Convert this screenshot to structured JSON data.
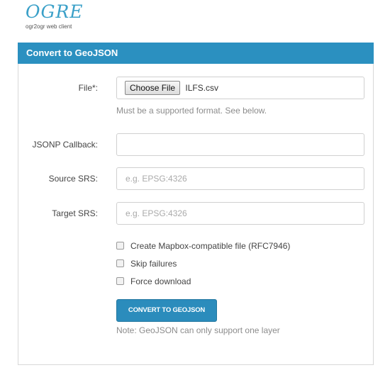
{
  "brand": {
    "logo_text": "OGRE",
    "tagline": "ogr2ogr web client"
  },
  "panel": {
    "title": "Convert to GeoJSON"
  },
  "form": {
    "file": {
      "label": "File*:",
      "button_label": "Choose File",
      "selected_file": "ILFS.csv",
      "help": "Must be a supported format. See below."
    },
    "jsonp": {
      "label": "JSONP Callback:",
      "value": "",
      "placeholder": ""
    },
    "source_srs": {
      "label": "Source SRS:",
      "placeholder": "e.g. EPSG:4326"
    },
    "target_srs": {
      "label": "Target SRS:",
      "placeholder": "e.g. EPSG:4326"
    },
    "checkboxes": [
      {
        "label": "Create Mapbox-compatible file (RFC7946)",
        "checked": false
      },
      {
        "label": "Skip failures",
        "checked": false
      },
      {
        "label": "Force download",
        "checked": false
      }
    ],
    "submit_label": "CONVERT TO GEOJSON",
    "note": "Note: GeoJSON can only support one layer"
  },
  "colors": {
    "accent": "#2b90c0",
    "logo": "#3aa0c8"
  }
}
